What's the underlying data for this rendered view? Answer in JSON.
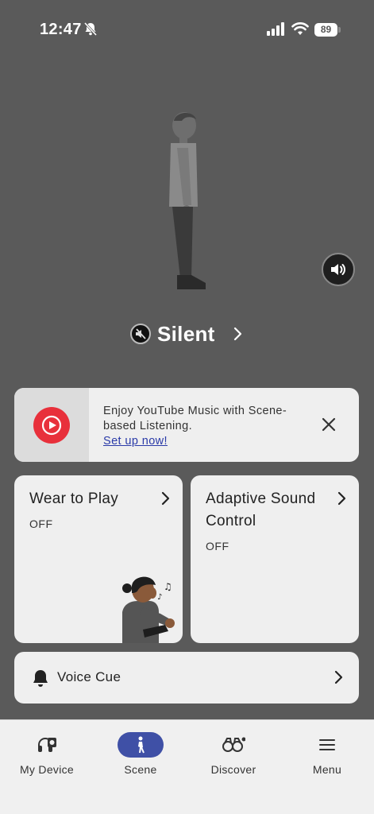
{
  "status_bar": {
    "time": "12:47",
    "battery": "89"
  },
  "hero": {
    "scene_name": "Silent"
  },
  "promo": {
    "text": "Enjoy YouTube Music with Scene-based Listening.",
    "link": "Set up now!"
  },
  "cards": {
    "wear_to_play": {
      "title": "Wear to Play",
      "status": "OFF"
    },
    "adaptive_sound": {
      "title": "Adaptive Sound Control",
      "status": "OFF"
    },
    "voice_cue": {
      "title": "Voice Cue"
    }
  },
  "nav": {
    "items": [
      {
        "label": "My Device",
        "icon": "headphones-icon"
      },
      {
        "label": "Scene",
        "icon": "walking-person-icon"
      },
      {
        "label": "Discover",
        "icon": "binoculars-icon"
      },
      {
        "label": "Menu",
        "icon": "menu-icon"
      }
    ],
    "active": "Scene"
  },
  "colors": {
    "background": "#5a5a5a",
    "accent": "#3f50a6",
    "youtube_red": "#e8303b",
    "card": "#efefef"
  }
}
